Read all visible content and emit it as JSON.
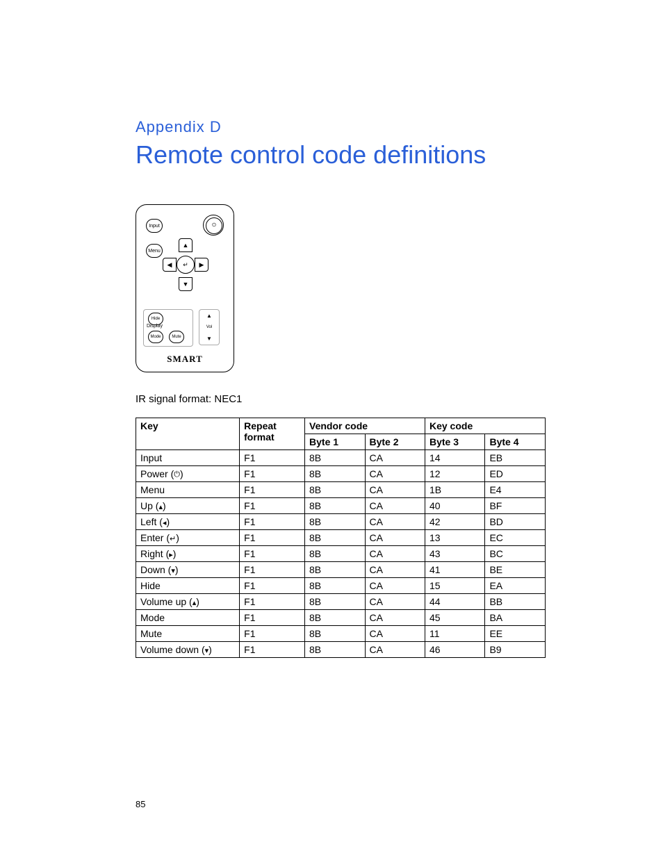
{
  "appendixLabel": "Appendix  D",
  "title": "Remote control code definitions",
  "remote": {
    "input": "Input",
    "menu": "Menu",
    "hide": "Hide",
    "mode": "Mode",
    "mute": "Mute",
    "display": "Display",
    "vol": "Vol",
    "brand": "SMART"
  },
  "irLine": "IR signal format: NEC1",
  "headers": {
    "key": "Key",
    "repeat1": "Repeat",
    "repeat2": "format",
    "vendor": "Vendor code",
    "keycode": "Key code",
    "b1": "Byte 1",
    "b2": "Byte 2",
    "b3": "Byte 3",
    "b4": "Byte 4"
  },
  "rows": [
    {
      "key": "Input",
      "sym": "",
      "rpt": "F1",
      "b1": "8B",
      "b2": "CA",
      "b3": "14",
      "b4": "EB"
    },
    {
      "key": "Power (",
      "sym": "⏻",
      "keyEnd": ")",
      "rpt": "F1",
      "b1": "8B",
      "b2": "CA",
      "b3": "12",
      "b4": "ED"
    },
    {
      "key": "Menu",
      "sym": "",
      "rpt": "F1",
      "b1": "8B",
      "b2": "CA",
      "b3": "1B",
      "b4": "E4"
    },
    {
      "key": "Up (",
      "sym": "▴",
      "keyEnd": ")",
      "rpt": "F1",
      "b1": "8B",
      "b2": "CA",
      "b3": "40",
      "b4": "BF"
    },
    {
      "key": "Left (",
      "sym": "◂",
      "keyEnd": ")",
      "rpt": "F1",
      "b1": "8B",
      "b2": "CA",
      "b3": "42",
      "b4": "BD"
    },
    {
      "key": "Enter (",
      "sym": "↵",
      "keyEnd": ")",
      "rpt": "F1",
      "b1": "8B",
      "b2": "CA",
      "b3": "13",
      "b4": "EC"
    },
    {
      "key": "Right (",
      "sym": "▸",
      "keyEnd": ")",
      "rpt": "F1",
      "b1": "8B",
      "b2": "CA",
      "b3": "43",
      "b4": "BC"
    },
    {
      "key": "Down (",
      "sym": "▾",
      "keyEnd": ")",
      "rpt": "F1",
      "b1": "8B",
      "b2": "CA",
      "b3": "41",
      "b4": "BE"
    },
    {
      "key": "Hide",
      "sym": "",
      "rpt": "F1",
      "b1": "8B",
      "b2": "CA",
      "b3": "15",
      "b4": "EA"
    },
    {
      "key": "Volume up (",
      "sym": "▴",
      "keyEnd": ")",
      "rpt": "F1",
      "b1": "8B",
      "b2": "CA",
      "b3": "44",
      "b4": "BB"
    },
    {
      "key": "Mode",
      "sym": "",
      "rpt": "F1",
      "b1": "8B",
      "b2": "CA",
      "b3": "45",
      "b4": "BA"
    },
    {
      "key": "Mute",
      "sym": "",
      "rpt": "F1",
      "b1": "8B",
      "b2": "CA",
      "b3": "11",
      "b4": "EE"
    },
    {
      "key": "Volume down (",
      "sym": "▾",
      "keyEnd": ")",
      "rpt": "F1",
      "b1": "8B",
      "b2": "CA",
      "b3": "46",
      "b4": "B9"
    }
  ],
  "pageNumber": "85"
}
